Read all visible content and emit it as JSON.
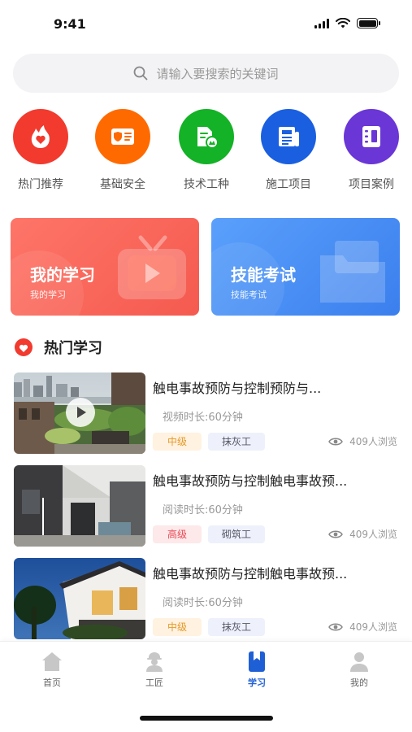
{
  "status_bar": {
    "time": "9:41"
  },
  "search": {
    "placeholder": "请输入要搜索的关键词"
  },
  "categories": [
    {
      "label": "热门推荐",
      "color": "#f23a2f",
      "icon": "flame-heart-icon"
    },
    {
      "label": "基础安全",
      "color": "#ff6a00",
      "icon": "id-card-shield-icon"
    },
    {
      "label": "技术工种",
      "color": "#14b226",
      "icon": "worker-badge-icon"
    },
    {
      "label": "施工项目",
      "color": "#1a5fe0",
      "icon": "newspaper-icon"
    },
    {
      "label": "项目案例",
      "color": "#6a36d6",
      "icon": "binder-icon"
    }
  ],
  "banners": [
    {
      "title": "我的学习",
      "subtitle": "我的学习",
      "color": "#fb6b60",
      "icon": "tv-play-icon"
    },
    {
      "title": "技能考试",
      "subtitle": "技能考试",
      "color": "#4a8ff5",
      "icon": "folder-icon"
    }
  ],
  "section": {
    "title": "热门学习"
  },
  "items": [
    {
      "title": "触电事故预防与控制预防与...",
      "duration": "视频时长:60分钟",
      "level": "中级",
      "level_type": "mid",
      "job": "抹灰工",
      "views": "409人浏览",
      "has_video": true
    },
    {
      "title": "触电事故预防与控制触电事故预...",
      "duration": "阅读时长:60分钟",
      "level": "高级",
      "level_type": "high",
      "job": "砌筑工",
      "views": "409人浏览",
      "has_video": false
    },
    {
      "title": "触电事故预防与控制触电事故预...",
      "duration": "阅读时长:60分钟",
      "level": "中级",
      "level_type": "mid",
      "job": "抹灰工",
      "views": "409人浏览",
      "has_video": false
    }
  ],
  "tabbar": {
    "items": [
      {
        "label": "首页",
        "icon": "home-icon"
      },
      {
        "label": "工匠",
        "icon": "worker-icon"
      },
      {
        "label": "学习",
        "icon": "bookmark-book-icon"
      },
      {
        "label": "我的",
        "icon": "person-icon"
      }
    ],
    "active_index": 2
  }
}
